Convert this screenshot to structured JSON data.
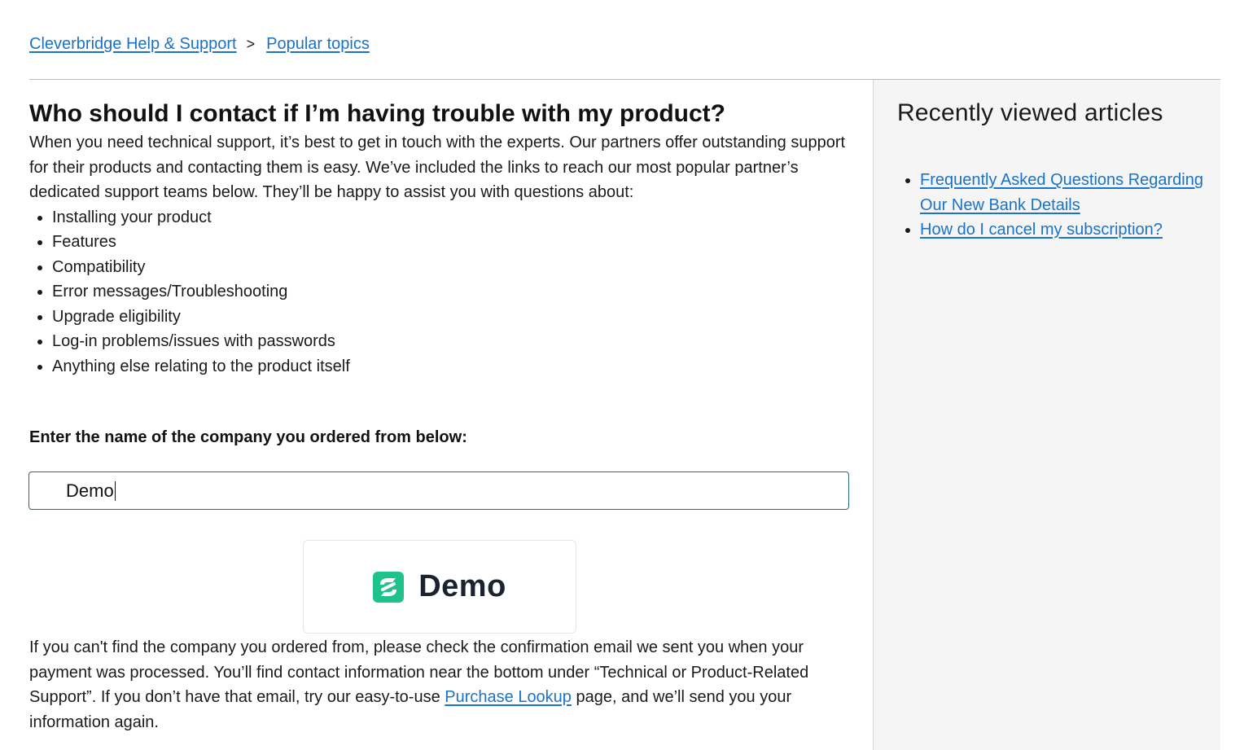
{
  "breadcrumb": {
    "home": "Cleverbridge Help & Support",
    "separator": ">",
    "current": "Popular topics"
  },
  "article": {
    "title": "Who should I contact if I’m having trouble with my product?",
    "intro": "When you need technical support, it’s best to get in touch with the experts. Our partners offer outstanding support for their products and contacting them is easy. We’ve included the links to reach our most popular partner’s dedicated support teams below. They’ll be happy to assist you with questions about:",
    "topics": [
      "Installing your product",
      "Features",
      "Compatibility",
      "Error messages/Troubleshooting",
      "Upgrade eligibility",
      "Log-in problems/issues with passwords",
      "Anything else relating to the product itself"
    ],
    "prompt": "Enter the name of the company you ordered from below:",
    "search_value": "Demo",
    "result_name": "Demo",
    "footer_before_link": "If you can't find the company you ordered from, please check the confirmation email we sent you when your payment was processed. You’ll find contact information near the bottom under “Technical or Product-Related Support”. If you don’t have that email, try our easy-to-use ",
    "footer_link": "Purchase Lookup",
    "footer_after_link": " page, and we’ll send you your information again."
  },
  "sidebar": {
    "title": "Recently viewed articles",
    "articles": [
      "Frequently Asked Questions Regarding Our New Bank Details",
      "How do I cancel my subscription?"
    ]
  },
  "colors": {
    "link": "#1a73c9",
    "logo_green": "#1fc28a",
    "input_border": "#1f6e7a"
  }
}
